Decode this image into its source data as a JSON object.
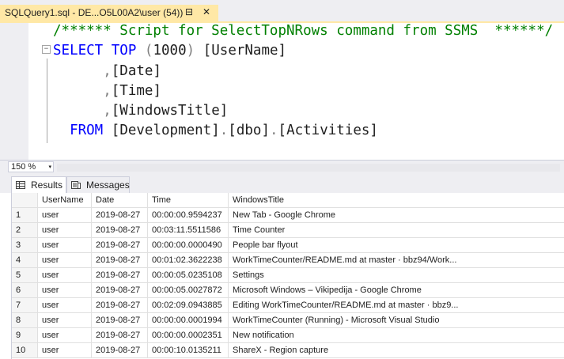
{
  "tab": {
    "title": "SQLQuery1.sql - DE...O5L00A2\\user (54))",
    "pin_glyph": "⊟",
    "close_glyph": "✕"
  },
  "editor": {
    "comment": "/****** Script for SelectTopNRows command from SSMS  ******/",
    "line2": {
      "kw1": "SELECT",
      "kw2": "TOP",
      "paren_open": "(",
      "number": "1000",
      "paren_close": ")",
      "col": "[UserName]"
    },
    "line3": {
      "comma": ",",
      "col": "[Date]"
    },
    "line4": {
      "comma": ",",
      "col": "[Time]"
    },
    "line5": {
      "comma": ",",
      "col": "[WindowsTitle]"
    },
    "line6": {
      "kw": "FROM",
      "db": "[Development]",
      "dot1": ".",
      "schema": "[dbo]",
      "dot2": ".",
      "table": "[Activities]"
    },
    "fold_glyph": "−"
  },
  "zoom": {
    "value": "150 %",
    "arrow": "▾"
  },
  "results_tabs": [
    {
      "label": "Results",
      "icon": "grid-icon",
      "active": true
    },
    {
      "label": "Messages",
      "icon": "messages-icon",
      "active": false
    }
  ],
  "grid": {
    "headers": [
      "",
      "UserName",
      "Date",
      "Time",
      "WindowsTitle"
    ],
    "rows": [
      [
        "1",
        "user",
        "2019-08-27",
        "00:00:00.9594237",
        "New Tab - Google Chrome"
      ],
      [
        "2",
        "user",
        "2019-08-27",
        "00:03:11.5511586",
        "Time Counter"
      ],
      [
        "3",
        "user",
        "2019-08-27",
        "00:00:00.0000490",
        "People bar flyout"
      ],
      [
        "4",
        "user",
        "2019-08-27",
        "00:01:02.3622238",
        "WorkTimeCounter/README.md at master · bbz94/Work..."
      ],
      [
        "5",
        "user",
        "2019-08-27",
        "00:00:05.0235108",
        "Settings"
      ],
      [
        "6",
        "user",
        "2019-08-27",
        "00:00:05.0027872",
        "Microsoft Windows – Vikipedija - Google Chrome"
      ],
      [
        "7",
        "user",
        "2019-08-27",
        "00:02:09.0943885",
        "Editing WorkTimeCounter/README.md at master · bbz9..."
      ],
      [
        "8",
        "user",
        "2019-08-27",
        "00:00:00.0001994",
        "WorkTimeCounter (Running) - Microsoft Visual Studio"
      ],
      [
        "9",
        "user",
        "2019-08-27",
        "00:00:00.0002351",
        "New notification"
      ],
      [
        "10",
        "user",
        "2019-08-27",
        "00:00:10.0135211",
        "ShareX - Region capture"
      ]
    ]
  },
  "colors": {
    "tab_active": "#ffe8a6",
    "keyword": "#0000ff",
    "comment": "#008000",
    "punct": "#808080",
    "chrome": "#eeeef2"
  }
}
